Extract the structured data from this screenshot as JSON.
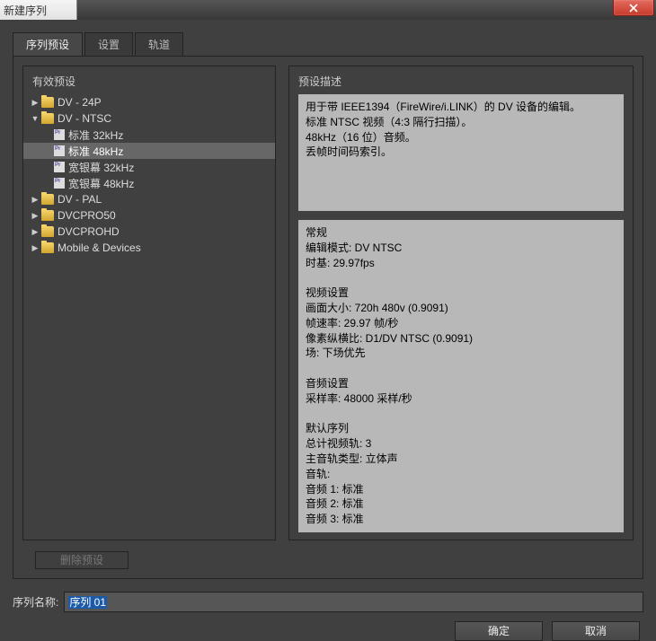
{
  "window": {
    "title": "新建序列"
  },
  "tabs": {
    "t1": "序列预设",
    "t2": "设置",
    "t3": "轨道"
  },
  "left": {
    "title": "有效预设",
    "n_dv24p": "DV - 24P",
    "n_dvntsc": "DV - NTSC",
    "p_std32": "标准 32kHz",
    "p_std48": "标准 48kHz",
    "p_wide32": "宽银幕 32kHz",
    "p_wide48": "宽银幕 48kHz",
    "n_dvpal": "DV - PAL",
    "n_dvcpro50": "DVCPRO50",
    "n_dvcprohd": "DVCPROHD",
    "n_mobile": "Mobile & Devices"
  },
  "right": {
    "title": "预设描述",
    "desc": "用于带 IEEE1394（FireWire/i.LINK）的 DV 设备的编辑。\n标准 NTSC 视频（4:3 隔行扫描）。\n48kHz（16 位）音频。\n丢帧时间码索引。",
    "spec": "常规\n编辑模式: DV NTSC\n时基: 29.97fps\n\n视频设置\n画面大小: 720h 480v (0.9091)\n帧速率: 29.97 帧/秒\n像素纵横比: D1/DV NTSC (0.9091)\n场: 下场优先\n\n音频设置\n采样率: 48000 采样/秒\n\n默认序列\n总计视频轨: 3\n主音轨类型: 立体声\n音轨:\n音频 1: 标准\n音频 2: 标准\n音频 3: 标准"
  },
  "delete_label": "删除预设",
  "seq_name_label": "序列名称:",
  "seq_name_value": "序列 01",
  "buttons": {
    "ok": "确定",
    "cancel": "取消"
  }
}
